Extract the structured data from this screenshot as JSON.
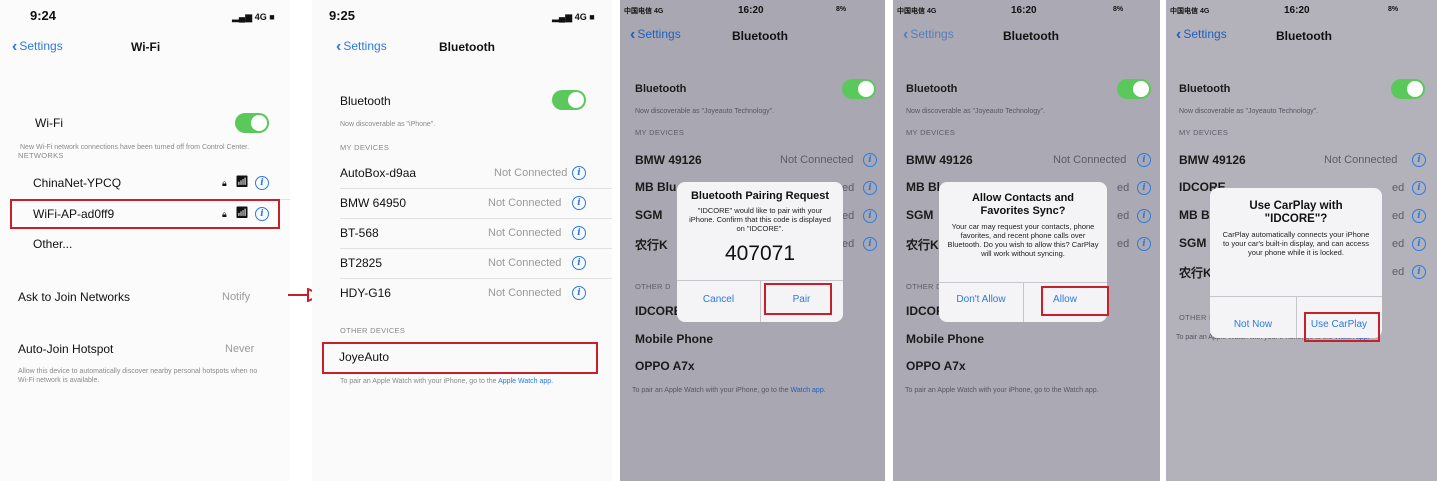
{
  "p1": {
    "time": "9:24",
    "signal": "4G",
    "back_label": "Settings",
    "title": "Wi-Fi",
    "wifi_label": "Wi-Fi",
    "wifi_note": "New Wi-Fi network connections have been turned off from Control Center.",
    "networks_header": "NETWORKS",
    "networks": [
      {
        "name": "ChinaNet-YPCQ"
      },
      {
        "name": "WiFi-AP-ad0ff9"
      }
    ],
    "other_label": "Other...",
    "ask_label": "Ask to Join Networks",
    "ask_value": "Notify",
    "autojoin_label": "Auto-Join Hotspot",
    "autojoin_value": "Never",
    "autojoin_note": "Allow this device to automatically discover nearby personal hotspots when no Wi-Fi network is available."
  },
  "p2": {
    "time": "9:25",
    "signal": "4G",
    "back_label": "Settings",
    "title": "Bluetooth",
    "bt_label": "Bluetooth",
    "bt_note": "Now discoverable as \"iPhone\".",
    "my_devices_header": "MY DEVICES",
    "devices": [
      {
        "name": "AutoBox-d9aa",
        "status": "Not Connected"
      },
      {
        "name": "BMW 64950",
        "status": "Not Connected"
      },
      {
        "name": "BT-568",
        "status": "Not Connected"
      },
      {
        "name": "BT2825",
        "status": "Not Connected"
      },
      {
        "name": "HDY-G16",
        "status": "Not Connected"
      }
    ],
    "other_devices_header": "OTHER DEVICES",
    "other_device": "JoyeAuto",
    "watch_note_pre": "To pair an Apple Watch with your iPhone, go to the ",
    "watch_note_link": "Apple Watch app."
  },
  "p3": {
    "carrier": "中国电信 4G",
    "time": "16:20",
    "battery": "8%",
    "back_label": "Settings",
    "title": "Bluetooth",
    "bt_label": "Bluetooth",
    "bt_note": "Now discoverable as \"Joyeauto Technology\".",
    "my_devices_header": "MY DEVICES",
    "device_bmw": "BMW 49126",
    "device_bmw_status": "Not Connected",
    "device_mb": "MB Blu",
    "device_sgm": "SGM",
    "device_cn": "农行K",
    "status_frag": "ed",
    "other_header": "OTHER D",
    "idcore": "IDCORE",
    "mobile": "Mobile Phone",
    "oppo": "OPPO A7x",
    "watch_note_pre": "To pair an Apple Watch with your iPhone, go to the ",
    "watch_note_link": "Watch app.",
    "dialog_title": "Bluetooth Pairing Request",
    "dialog_body": "\"IDCORE\" would like to pair with your iPhone. Confirm that this code is displayed on \"IDCORE\".",
    "dialog_code": "407071",
    "cancel": "Cancel",
    "pair": "Pair"
  },
  "p4": {
    "carrier": "中国电信 4G",
    "time": "16:20",
    "battery": "8%",
    "back_label": "Settings",
    "title": "Bluetooth",
    "bt_label": "Bluetooth",
    "bt_note": "Now discoverable as \"Joyeauto Technology\".",
    "my_devices_header": "MY DEVICES",
    "device_bmw": "BMW 49126",
    "device_bmw_status": "Not Connected",
    "device_mb": "MB Blu",
    "device_sgm": "SGM",
    "device_cn": "农行K",
    "status_frag": "ed",
    "other_header": "OTHER D",
    "idcore": "IDCORE",
    "mobile": "Mobile Phone",
    "oppo": "OPPO A7x",
    "watch_note": "To pair an Apple Watch with your iPhone, go to the Watch app.",
    "dialog_title": "Allow Contacts and Favorites Sync?",
    "dialog_body": "Your car may request your contacts, phone favorites, and recent phone calls over Bluetooth. Do you wish to allow this? CarPlay will work without syncing.",
    "dont_allow": "Don't Allow",
    "allow": "Allow"
  },
  "p5": {
    "carrier": "中国电信 4G",
    "time": "16:20",
    "battery": "8%",
    "back_label": "Settings",
    "title": "Bluetooth",
    "bt_label": "Bluetooth",
    "bt_note": "Now discoverable as \"Joyeauto Technology\".",
    "my_devices_header": "MY DEVICES",
    "device_bmw": "BMW 49126",
    "device_bmw_status": "Not Connected",
    "device_idcore": "IDCORE",
    "device_mb": "MB Blu",
    "device_sgm": "SGM",
    "device_cn": "农行K",
    "status_frag": "ed",
    "other_header": "OTHER DEVICES",
    "watch_note_pre": "To pair an Apple Watch with your iPhone, go to the ",
    "watch_note_link": "Watch app.",
    "dialog_title": "Use CarPlay with \"IDCORE\"?",
    "dialog_body": "CarPlay automatically connects your iPhone to your car's built-in display, and can access your phone while it is locked.",
    "not_now": "Not Now",
    "use_carplay": "Use CarPlay"
  },
  "colors": {
    "accent": "#2a7ae2",
    "toggle": "#5bc85b",
    "highlight": "#c8202a"
  }
}
